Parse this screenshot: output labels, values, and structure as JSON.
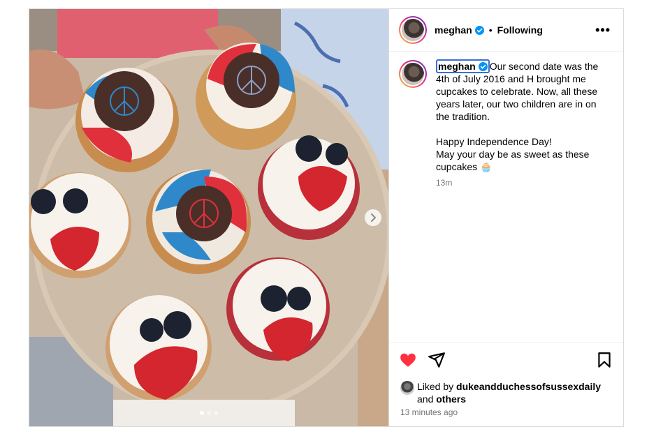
{
  "post": {
    "username": "meghan",
    "verified_icon": "verified-badge-icon",
    "separator": "•",
    "follow_status": "Following",
    "more_label": "•••",
    "caption": {
      "username": "meghan",
      "text": "Our second date was the 4th of July 2016 and H brought me cupcakes to celebrate. Now, all these years later, our two children are in on the tradition.\n\nHappy Independence Day!\nMay your day be as sweet as these cupcakes 🧁",
      "time": "13m"
    },
    "likes": {
      "prefix": "Liked by",
      "user": "dukeandduchessofsussexdaily",
      "joiner": "and",
      "others": "others"
    },
    "time_ago": "13 minutes ago",
    "carousel": {
      "slides": 3,
      "current": 1
    }
  },
  "colors": {
    "like_red": "#ff3040",
    "verified_blue": "#0095f6",
    "focus_outline": "#3b6fd4",
    "muted_text": "#737373"
  }
}
